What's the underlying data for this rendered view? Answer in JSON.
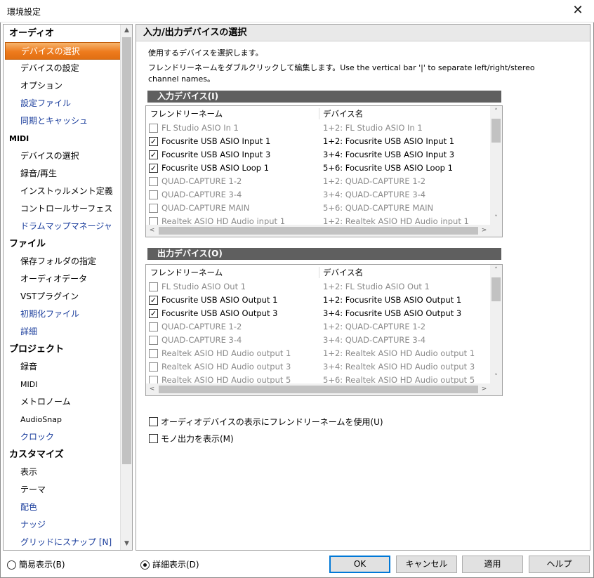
{
  "window": {
    "title": "環境設定",
    "close_glyph": "✕"
  },
  "sidebar": {
    "items": [
      {
        "label": "オーディオ",
        "type": "cat"
      },
      {
        "label": "デバイスの選択",
        "type": "sub",
        "selected": true
      },
      {
        "label": "デバイスの設定",
        "type": "sub"
      },
      {
        "label": "オプション",
        "type": "sub"
      },
      {
        "label": "設定ファイル",
        "type": "sub",
        "link": true
      },
      {
        "label": "同期とキャッシュ",
        "type": "sub",
        "link": true
      },
      {
        "label": "MIDI",
        "type": "cat",
        "small": true
      },
      {
        "label": "デバイスの選択",
        "type": "sub"
      },
      {
        "label": "録音/再生",
        "type": "sub"
      },
      {
        "label": "インストゥルメント定義",
        "type": "sub"
      },
      {
        "label": "コントロールサーフェス",
        "type": "sub"
      },
      {
        "label": "ドラムマップマネージャ",
        "type": "sub",
        "link": true
      },
      {
        "label": "ファイル",
        "type": "cat"
      },
      {
        "label": "保存フォルダの指定",
        "type": "sub"
      },
      {
        "label": "オーディオデータ",
        "type": "sub"
      },
      {
        "label": "VSTプラグイン",
        "type": "sub"
      },
      {
        "label": "初期化ファイル",
        "type": "sub",
        "link": true
      },
      {
        "label": "詳細",
        "type": "sub",
        "link": true
      },
      {
        "label": "プロジェクト",
        "type": "cat"
      },
      {
        "label": "録音",
        "type": "sub"
      },
      {
        "label": "MIDI",
        "type": "sub",
        "small": true
      },
      {
        "label": "メトロノーム",
        "type": "sub"
      },
      {
        "label": "AudioSnap",
        "type": "sub",
        "small": true
      },
      {
        "label": "クロック",
        "type": "sub",
        "link": true
      },
      {
        "label": "カスタマイズ",
        "type": "cat"
      },
      {
        "label": "表示",
        "type": "sub"
      },
      {
        "label": "テーマ",
        "type": "sub"
      },
      {
        "label": "配色",
        "type": "sub",
        "link": true
      },
      {
        "label": "ナッジ",
        "type": "sub",
        "link": true
      },
      {
        "label": "グリッドにスナップ [N]",
        "type": "sub",
        "link": true
      }
    ]
  },
  "panel": {
    "header": "入力/出力デバイスの選択",
    "desc1": "使用するデバイスを選択します。",
    "desc2": "フレンドリーネームをダブルクリックして編集します。Use the vertical bar '|' to separate left/right/stereo",
    "desc3": "channel names。",
    "input": {
      "section": "入力デバイス(I)",
      "col_friendly": "フレンドリーネーム",
      "col_device": "デバイス名",
      "rows": [
        {
          "name": "FL Studio ASIO In 1",
          "device": "1+2: FL Studio ASIO In 1",
          "checked": false,
          "disabled": true
        },
        {
          "name": "Focusrite USB ASIO Input 1",
          "device": "1+2: Focusrite USB ASIO Input 1",
          "checked": true,
          "disabled": false
        },
        {
          "name": "Focusrite USB ASIO Input 3",
          "device": "3+4: Focusrite USB ASIO Input 3",
          "checked": true,
          "disabled": false
        },
        {
          "name": "Focusrite USB ASIO Loop 1",
          "device": "5+6: Focusrite USB ASIO Loop 1",
          "checked": true,
          "disabled": false
        },
        {
          "name": "QUAD-CAPTURE 1-2",
          "device": "1+2: QUAD-CAPTURE 1-2",
          "checked": false,
          "disabled": true
        },
        {
          "name": "QUAD-CAPTURE 3-4",
          "device": "3+4: QUAD-CAPTURE 3-4",
          "checked": false,
          "disabled": true
        },
        {
          "name": "QUAD-CAPTURE MAIN",
          "device": "5+6: QUAD-CAPTURE MAIN",
          "checked": false,
          "disabled": true
        },
        {
          "name": "Realtek ASIO HD Audio input 1",
          "device": "1+2: Realtek ASIO HD Audio input 1",
          "checked": false,
          "disabled": true
        }
      ]
    },
    "output": {
      "section": "出力デバイス(O)",
      "col_friendly": "フレンドリーネーム",
      "col_device": "デバイス名",
      "rows": [
        {
          "name": "FL Studio ASIO Out 1",
          "device": "1+2: FL Studio ASIO Out 1",
          "checked": false,
          "disabled": true
        },
        {
          "name": "Focusrite USB ASIO Output 1",
          "device": "1+2: Focusrite USB ASIO Output 1",
          "checked": true,
          "disabled": false
        },
        {
          "name": "Focusrite USB ASIO Output 3",
          "device": "3+4: Focusrite USB ASIO Output 3",
          "checked": true,
          "disabled": false
        },
        {
          "name": "QUAD-CAPTURE 1-2",
          "device": "1+2: QUAD-CAPTURE 1-2",
          "checked": false,
          "disabled": true
        },
        {
          "name": "QUAD-CAPTURE 3-4",
          "device": "3+4: QUAD-CAPTURE 3-4",
          "checked": false,
          "disabled": true
        },
        {
          "name": "Realtek ASIO HD Audio output 1",
          "device": "1+2: Realtek ASIO HD Audio output 1",
          "checked": false,
          "disabled": true
        },
        {
          "name": "Realtek ASIO HD Audio output 3",
          "device": "3+4: Realtek ASIO HD Audio output 3",
          "checked": false,
          "disabled": true
        },
        {
          "name": "Realtek ASIO HD Audio output 5",
          "device": "5+6: Realtek ASIO HD Audio output 5",
          "checked": false,
          "disabled": true
        }
      ]
    },
    "opt_friendly": "オーディオデバイスの表示にフレンドリーネームを使用(U)",
    "opt_mono": "モノ出力を表示(M)"
  },
  "footer": {
    "simple": "簡易表示(B)",
    "detail": "詳細表示(D)",
    "ok": "OK",
    "cancel": "キャンセル",
    "apply": "適用",
    "help": "ヘルプ"
  },
  "icons": {
    "up": "up-arrow-icon",
    "down": "down-arrow-icon",
    "left": "left-arrow-icon",
    "right": "right-arrow-icon",
    "check": "check-icon"
  }
}
